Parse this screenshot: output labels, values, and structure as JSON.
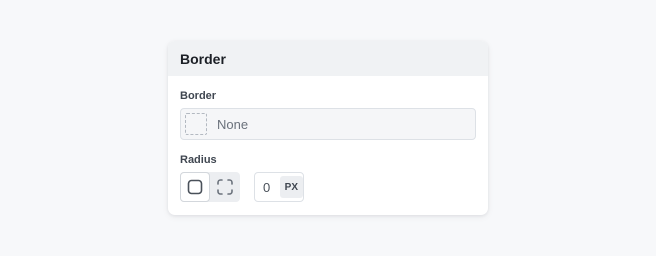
{
  "panel": {
    "title": "Border"
  },
  "border": {
    "label": "Border",
    "value": "None",
    "swatch_icon": "dashed-square-icon"
  },
  "radius": {
    "label": "Radius",
    "modes": [
      {
        "icon": "rounded-square-icon",
        "active": true
      },
      {
        "icon": "individual-corners-icon",
        "active": false
      }
    ],
    "value": "0",
    "unit": "PX"
  },
  "colors": {
    "background": "#f7f8fa",
    "panel_header": "#f0f2f4",
    "input_fill": "#f5f6f8"
  }
}
